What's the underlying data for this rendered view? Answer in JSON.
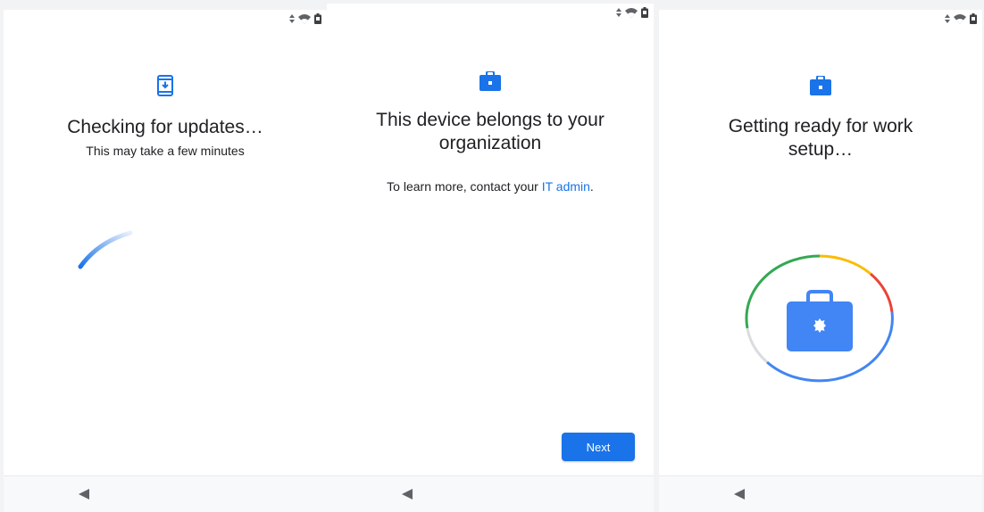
{
  "colors": {
    "accent": "#1a73e8",
    "text": "#202124",
    "ring_green": "#34a853",
    "ring_yellow": "#fbbc04",
    "ring_red": "#ea4335",
    "ring_blue": "#4285f4",
    "ring_grey": "#dadce0"
  },
  "status_icons": [
    "signal-arrows-icon",
    "wifi-icon",
    "battery-icon"
  ],
  "screens": [
    {
      "icon": "system-update-icon",
      "title": "Checking for updates…",
      "subtitle": "This may take a few minutes",
      "indicator": "progress-spinner"
    },
    {
      "icon": "briefcase-icon",
      "title_line1": "This device belongs to your",
      "title_line2": "organization",
      "body_prefix": "To learn more, contact your ",
      "body_link": "IT admin",
      "body_suffix": ".",
      "next_label": "Next"
    },
    {
      "icon": "briefcase-icon",
      "title_line1": "Getting ready for work",
      "title_line2": "setup…",
      "indicator": "work-profile-ring"
    }
  ],
  "nav": {
    "back_icon": "back-triangle-icon"
  }
}
